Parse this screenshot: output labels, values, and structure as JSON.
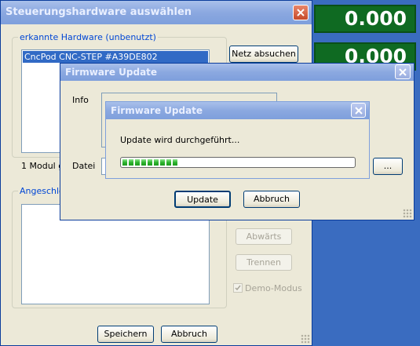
{
  "dro": {
    "value1": "0.000",
    "value2": "0.000"
  },
  "hw_dialog": {
    "title": "Steuerungshardware auswählen",
    "detected_group": "erkannte Hardware (unbenutzt)",
    "detected_item": "CncPod CNC-STEP #A39DE802",
    "scan_button": "Netz absuchen",
    "count_text": "1 Modul ge",
    "connected_group": "Angeschlo",
    "down_button": "Abwärts",
    "disconnect_button": "Trennen",
    "demo_label": "Demo-Modus",
    "demo_checked": true,
    "save_button": "Speichern",
    "cancel_button": "Abbruch"
  },
  "fw_dialog": {
    "title": "Firmware Update",
    "info_label": "Info",
    "file_label": "Datei",
    "browse_button": "...",
    "update_button": "Update",
    "cancel_button": "Abbruch"
  },
  "progress_dialog": {
    "title": "Firmware Update",
    "message": "Update wird durchgeführt...",
    "progress": 0.25,
    "progress_segments": 9
  }
}
